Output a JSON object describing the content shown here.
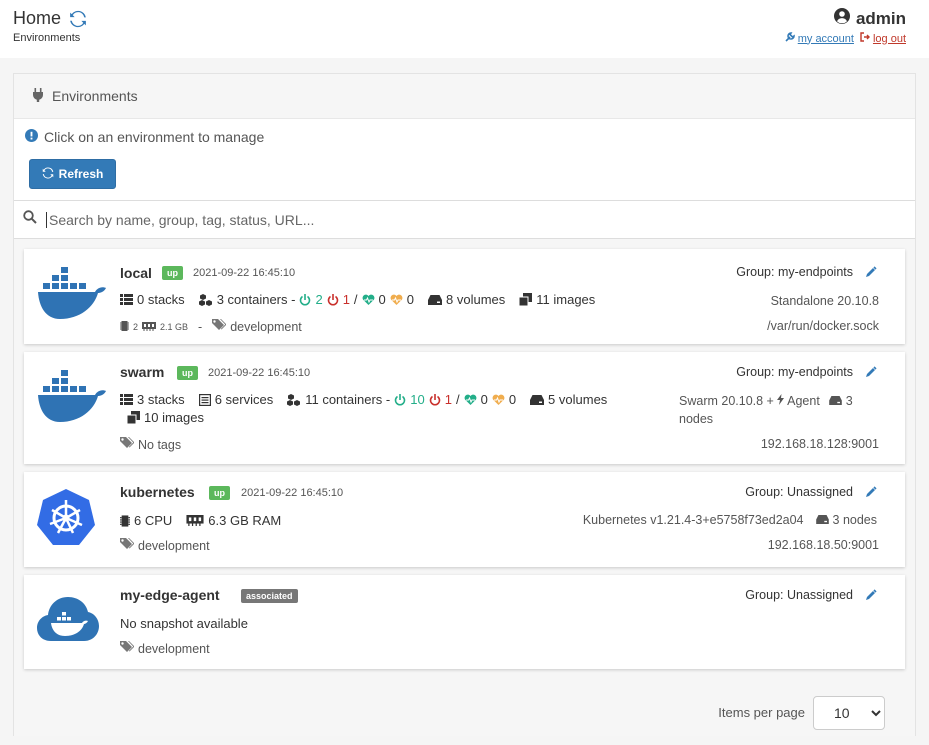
{
  "header": {
    "title": "Home",
    "breadcrumb": "Environments",
    "user": "admin",
    "my_account": "my account",
    "log_out": "log out"
  },
  "widget": {
    "title": "Environments",
    "hint": "Click on an environment to manage",
    "refresh_label": "Refresh",
    "search_placeholder": "Search by name, group, tag, status, URL..."
  },
  "environments": [
    {
      "name": "local",
      "status": "up",
      "time": "2021-09-22 16:45:10",
      "group": "Group: my-endpoints",
      "stacks": "0 stacks",
      "containers": "3 containers -",
      "running": "2",
      "stopped": "1",
      "sep": "/",
      "healthy": "0",
      "unhealthy": "0",
      "volumes": "8 volumes",
      "images": "11 images",
      "cpu": "2",
      "ram": "2.1 GB",
      "dash": "-",
      "tag": "development",
      "platform": "Standalone 20.10.8",
      "url": "/var/run/docker.sock"
    },
    {
      "name": "swarm",
      "status": "up",
      "time": "2021-09-22 16:45:10",
      "group": "Group: my-endpoints",
      "stacks": "3 stacks",
      "services": "6 services",
      "containers": "11 containers -",
      "running": "10",
      "stopped": "1",
      "sep": "/",
      "healthy": "0",
      "unhealthy": "0",
      "volumes": "5 volumes",
      "images": "10 images",
      "tag": "No tags",
      "platform": "Swarm 20.10.8 +",
      "agent": "Agent",
      "nodes_num": "3",
      "nodes_word": "nodes",
      "url": "192.168.18.128:9001"
    },
    {
      "name": "kubernetes",
      "status": "up",
      "time": "2021-09-22 16:45:10",
      "group": "Group: Unassigned",
      "cpu": "6 CPU",
      "ram": "6.3 GB RAM",
      "tag": "development",
      "platform": "Kubernetes v1.21.4-3+e5758f73ed2a04",
      "nodes": "3 nodes",
      "url": "192.168.18.50:9001"
    },
    {
      "name": "my-edge-agent",
      "status": "associated",
      "group": "Group: Unassigned",
      "snapshot": "No snapshot available",
      "tag": "development"
    }
  ],
  "pagination": {
    "label": "Items per page",
    "selected": "10"
  },
  "colors": {
    "primary": "#337ab7",
    "up": "#5cb85c",
    "associated": "#777777",
    "running": "#23ae89",
    "stopped": "#c9302c",
    "unhealthy": "#f0ad4e"
  }
}
